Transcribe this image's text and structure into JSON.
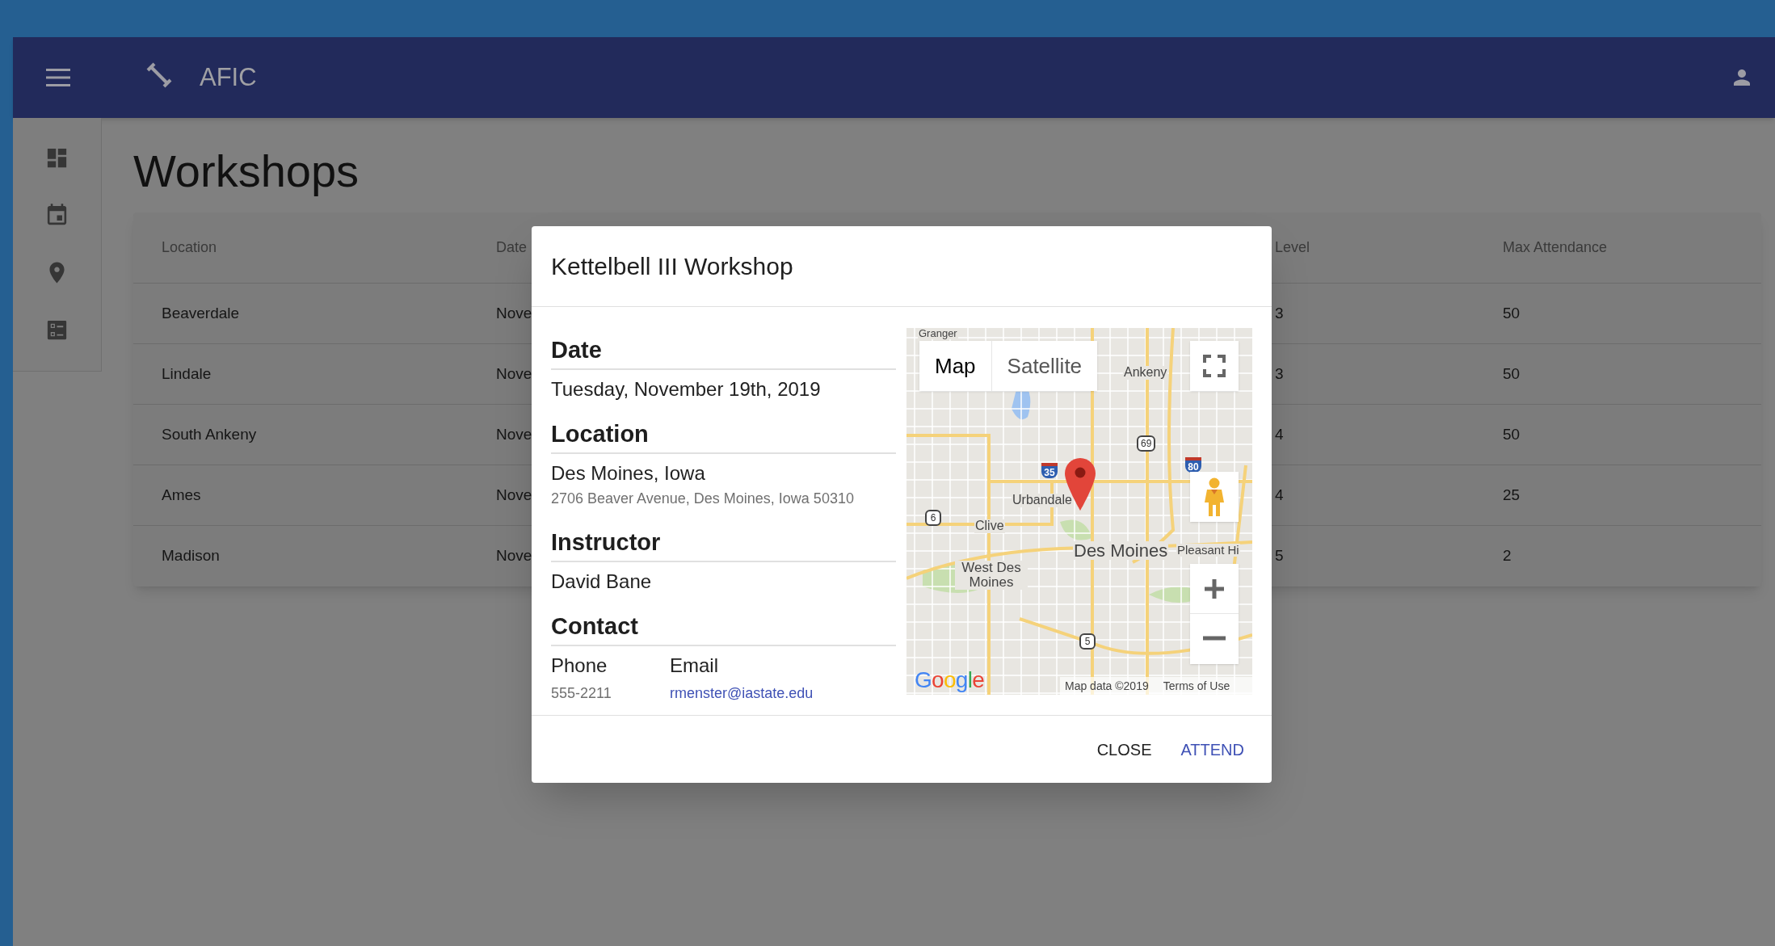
{
  "app_bar": {
    "title": "AFIC"
  },
  "page": {
    "title": "Workshops"
  },
  "table": {
    "columns": [
      "Location",
      "Date",
      "Level",
      "Max Attendance"
    ],
    "rows": [
      {
        "location": "Beaverdale",
        "date": "Nove",
        "level": "3",
        "max_attendance": "50"
      },
      {
        "location": "Lindale",
        "date": "Nove",
        "level": "3",
        "max_attendance": "50"
      },
      {
        "location": "South Ankeny",
        "date": "Nove",
        "level": "4",
        "max_attendance": "50"
      },
      {
        "location": "Ames",
        "date": "Nove",
        "level": "4",
        "max_attendance": "25"
      },
      {
        "location": "Madison",
        "date": "Nove",
        "level": "5",
        "max_attendance": "2"
      }
    ]
  },
  "dialog": {
    "title": "Kettelbell III Workshop",
    "sections": [
      {
        "kind": "text",
        "heading": "Date",
        "primary": "Tuesday, November 19th, 2019"
      },
      {
        "kind": "text",
        "heading": "Location",
        "primary": "Des Moines, Iowa",
        "secondary": "2706 Beaver Avenue, Des Moines, Iowa 50310"
      },
      {
        "kind": "text",
        "heading": "Instructor",
        "primary": "David Bane"
      },
      {
        "kind": "contact",
        "heading": "Contact",
        "phone_label": "Phone",
        "phone": "555-2211",
        "email_label": "Email",
        "email": "rmenster@iastate.edu"
      }
    ],
    "map": {
      "tabs": [
        {
          "label": "Map",
          "selected": true
        },
        {
          "label": "Satellite",
          "selected": false
        }
      ],
      "place_labels": [
        "Granger",
        "Ankeny",
        "Urbandale",
        "Clive",
        "Des Moines",
        "West Des Moines",
        "Pleasant Hi"
      ],
      "route_shields": [
        "35",
        "69",
        "80",
        "6",
        "5"
      ],
      "logo": "Google",
      "attribution": "Map data ©2019",
      "terms": "Terms of Use"
    },
    "buttons": [
      {
        "label": "CLOSE",
        "kind": "plain"
      },
      {
        "label": "ATTEND",
        "kind": "primary"
      }
    ]
  }
}
